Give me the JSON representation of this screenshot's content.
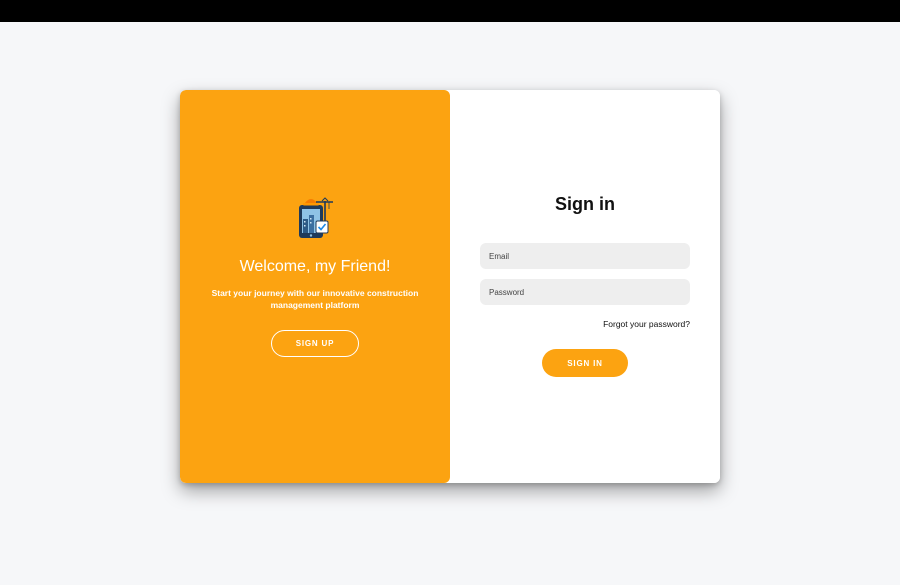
{
  "colors": {
    "accent": "#fca311",
    "background": "#f6f7f9",
    "field_bg": "#eeeeee"
  },
  "left_panel": {
    "logo_icon": "construction-tablet-icon",
    "welcome_title": "Welcome, my Friend!",
    "tagline": "Start your journey with our innovative construction management platform",
    "signup_label": "SIGN UP"
  },
  "signin_form": {
    "title": "Sign in",
    "email_placeholder": "Email",
    "email_value": "",
    "password_placeholder": "Password",
    "password_value": "",
    "forgot_label": "Forgot your password?",
    "signin_label": "SIGN IN"
  }
}
